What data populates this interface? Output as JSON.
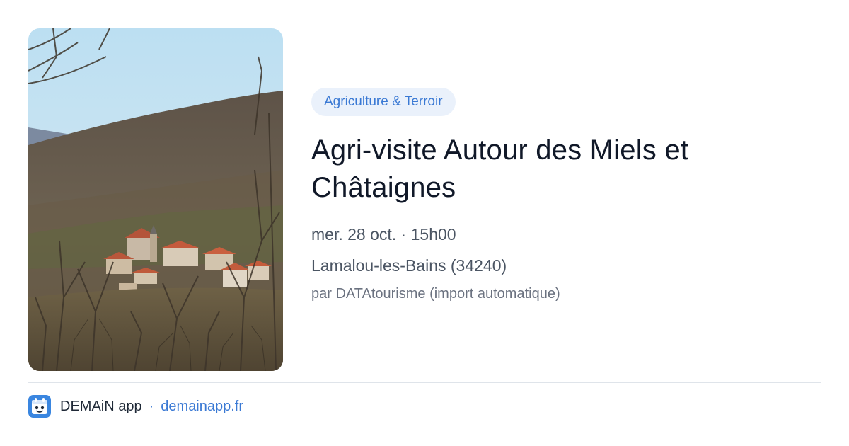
{
  "event": {
    "category": "Agriculture & Terroir",
    "title": "Agri-visite Autour des Miels et Châtaignes",
    "date": "mer. 28 oct. · 15h00",
    "location": "Lamalou-les-Bains (34240)",
    "source": "par DATAtourisme (import automatique)",
    "image_icon": "village-landscape-photo"
  },
  "footer": {
    "app_name": "DEMAiN app",
    "separator": "·",
    "link": "demainapp.fr",
    "logo_icon": "demain-app-logo"
  },
  "colors": {
    "accent": "#3a79d4",
    "badge_bg": "#eaf1fb",
    "title": "#101828",
    "muted": "#4b5563"
  }
}
